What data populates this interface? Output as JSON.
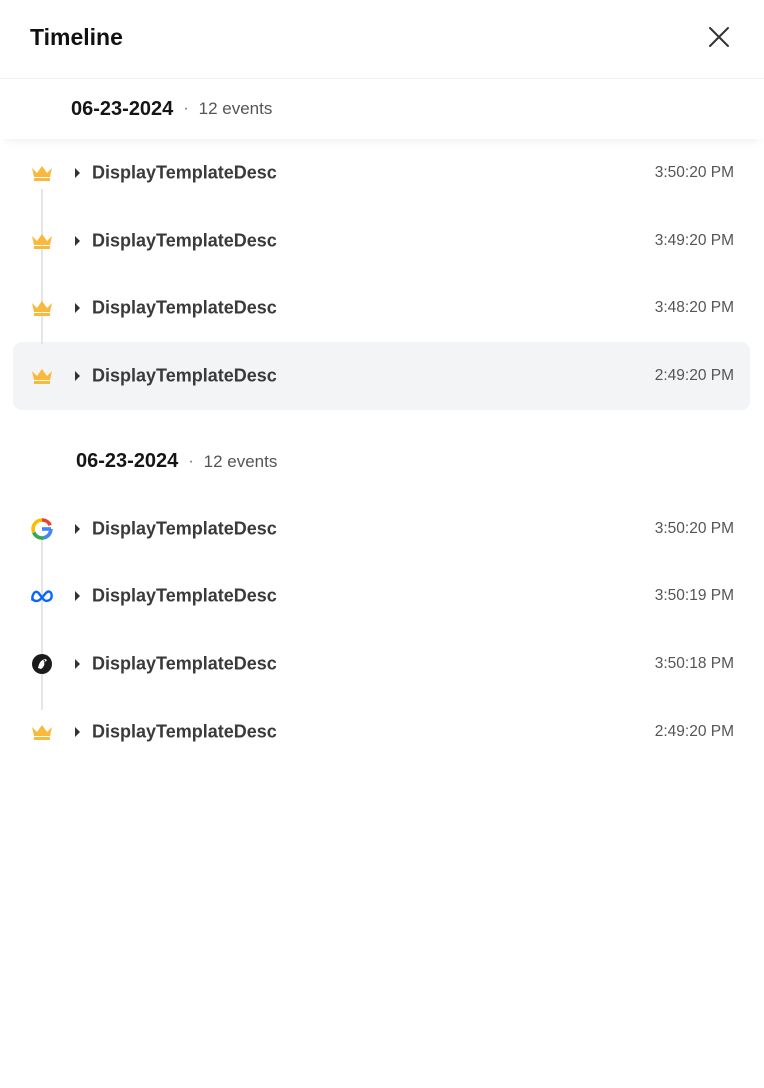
{
  "panel": {
    "title": "Timeline"
  },
  "groups": [
    {
      "date": "06-23-2024",
      "separator": "·",
      "count": "12 events",
      "events": [
        {
          "label": "DisplayTemplateDesc",
          "time": "3:50:20 PM",
          "icon": "crown-icon"
        },
        {
          "label": "DisplayTemplateDesc",
          "time": "3:49:20 PM",
          "icon": "crown-icon"
        },
        {
          "label": "DisplayTemplateDesc",
          "time": "3:48:20 PM",
          "icon": "crown-icon"
        },
        {
          "label": "DisplayTemplateDesc",
          "time": "2:49:20 PM",
          "icon": "crown-icon"
        }
      ]
    },
    {
      "date": "06-23-2024",
      "separator": "·",
      "count": "12 events",
      "events": [
        {
          "label": "DisplayTemplateDesc",
          "time": "3:50:20 PM",
          "icon": "google-icon"
        },
        {
          "label": "DisplayTemplateDesc",
          "time": "3:50:19 PM",
          "icon": "meta-icon"
        },
        {
          "label": "DisplayTemplateDesc",
          "time": "3:50:18 PM",
          "icon": "bird-logo-icon"
        },
        {
          "label": "DisplayTemplateDesc",
          "time": "2:49:20 PM",
          "icon": "crown-icon"
        }
      ]
    }
  ],
  "colors": {
    "crown": "#f9b93c",
    "highlight_bg": "#f2f4f5",
    "connector": "#e3e5e8",
    "meta_blue": "#0866ff"
  }
}
